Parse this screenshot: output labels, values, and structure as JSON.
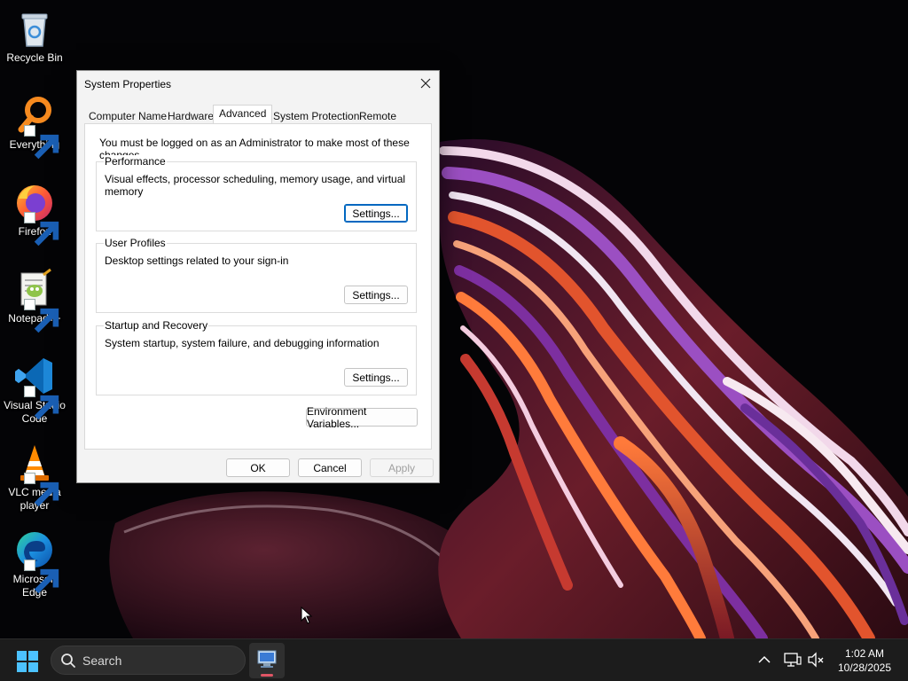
{
  "desktop": {
    "icons": [
      {
        "label": "Recycle Bin"
      },
      {
        "label": "Everything"
      },
      {
        "label": "Firefox"
      },
      {
        "label": "Notepad++"
      },
      {
        "label_line1": "Visual Studio",
        "label_line2": "Code"
      },
      {
        "label_line1": "VLC media",
        "label_line2": "player"
      },
      {
        "label_line1": "Microsoft",
        "label_line2": "Edge"
      }
    ]
  },
  "dialog": {
    "title": "System Properties",
    "tabs": [
      {
        "label": "Computer Name"
      },
      {
        "label": "Hardware"
      },
      {
        "label": "Advanced",
        "active": true
      },
      {
        "label": "System Protection"
      },
      {
        "label": "Remote"
      }
    ],
    "admin_note": "You must be logged on as an Administrator to make most of these changes.",
    "groups": {
      "performance": {
        "title": "Performance",
        "description": "Visual effects, processor scheduling, memory usage, and virtual memory",
        "button": "Settings..."
      },
      "user_profiles": {
        "title": "User Profiles",
        "description": "Desktop settings related to your sign-in",
        "button": "Settings..."
      },
      "startup_recovery": {
        "title": "Startup and Recovery",
        "description": "System startup, system failure, and debugging information",
        "button": "Settings..."
      }
    },
    "env_button": "Environment Variables...",
    "ok_button": "OK",
    "cancel_button": "Cancel",
    "apply_button": "Apply"
  },
  "taskbar": {
    "search_placeholder": "Search",
    "clock_time": "1:02 AM",
    "clock_date": "10/28/2025"
  },
  "colors": {
    "accent": "#0067c0",
    "taskbar_bg": "#1c1c1c",
    "dialog_bg": "#f3f3f3"
  }
}
